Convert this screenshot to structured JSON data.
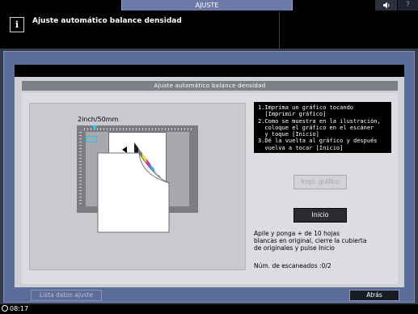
{
  "top_tabs": {
    "ajuste": "AJUSTE",
    "sound_icon": "speaker-icon",
    "help": "?"
  },
  "message": {
    "icon": "info-icon",
    "icon_glyph": "i",
    "text": "Ajuste automático balance densidad"
  },
  "dialog": {
    "title": "Ajuste automático balance densidad",
    "illustration_label": "2inch/50mm",
    "instructions": [
      "1.Imprima un gráfico tocando",
      "  [Imprimir gráfico]",
      "2.Como se muestra en la ilustración,",
      "  coloque el gráfico en el escáner",
      "  y toque [Inicio]",
      "3.Dé la vuelta al gráfico y después",
      "  vuelva a tocar [Inicio]"
    ],
    "print_chart_button": "Impr. gráfico",
    "start_button": "Inicio",
    "stack_instructions": [
      "Apile y ponga + de 10 hojas",
      "blancas en original, cierre la cubierta",
      "de originales y pulse Inicio"
    ],
    "scan_count": "Núm. de escaneados  :0/2"
  },
  "footer": {
    "list_button": "Lista datos ajuste",
    "back_button": "Atrás"
  },
  "status": {
    "time": "08:17",
    "clock_icon": "clock-icon"
  },
  "colors": {
    "tab_active": "#6c7aa8",
    "frame": "#5b6d9a",
    "accent_cyan": "#27c6ee"
  }
}
